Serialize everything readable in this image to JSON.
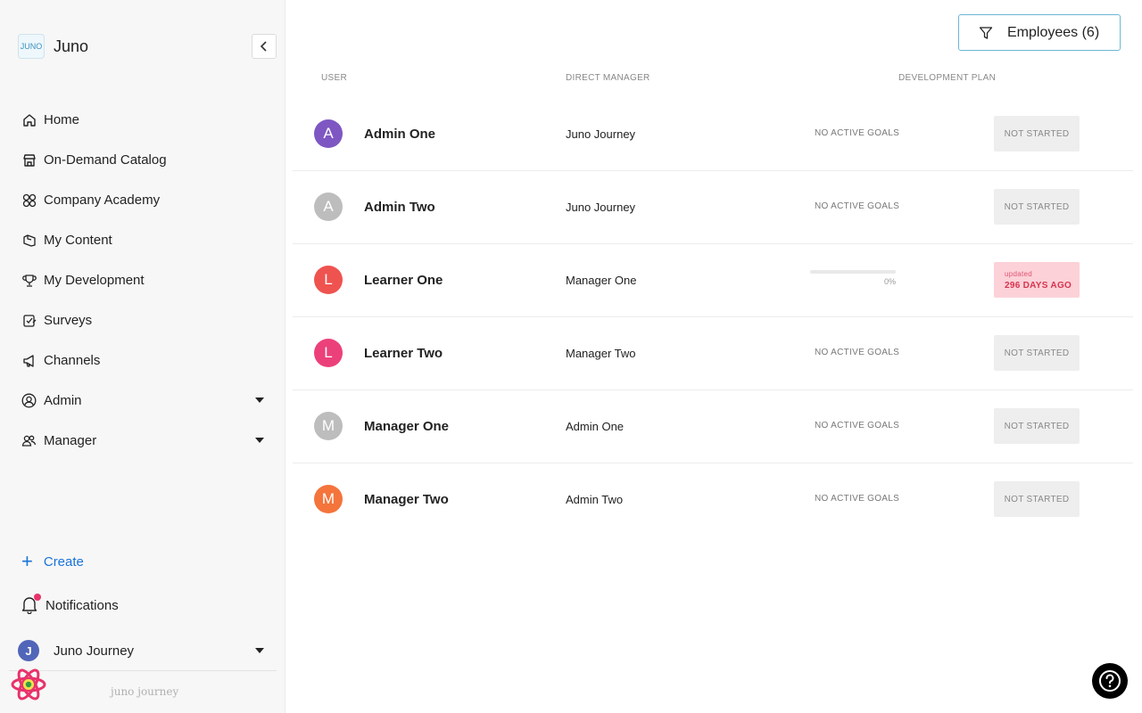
{
  "brand": {
    "name": "Juno",
    "logo_text": "JUNO"
  },
  "sidebar": {
    "items": [
      {
        "label": "Home",
        "icon": "home-icon"
      },
      {
        "label": "On-Demand Catalog",
        "icon": "store-icon"
      },
      {
        "label": "Company Academy",
        "icon": "grid-circles-icon"
      },
      {
        "label": "My Content",
        "icon": "folder-icon"
      },
      {
        "label": "My Development",
        "icon": "trophy-icon"
      },
      {
        "label": "Surveys",
        "icon": "survey-icon"
      },
      {
        "label": "Channels",
        "icon": "megaphone-icon"
      },
      {
        "label": "Admin",
        "icon": "user-circle-icon"
      },
      {
        "label": "Manager",
        "icon": "users-icon"
      }
    ],
    "create_label": "Create",
    "notifications_label": "Notifications",
    "user": {
      "initial": "J",
      "name": "Juno Journey"
    },
    "footer_logo": "juno journey"
  },
  "filter": {
    "label": "Employees (6)"
  },
  "table": {
    "headers": {
      "user": "USER",
      "manager": "DIRECT MANAGER",
      "plan": "DEVELOPMENT PLAN"
    },
    "rows": [
      {
        "initial": "A",
        "name": "Admin One",
        "manager": "Juno Journey",
        "goals": "NO ACTIVE GOALS",
        "status": "NOT STARTED",
        "color": "#7e57c2"
      },
      {
        "initial": "A",
        "name": "Admin Two",
        "manager": "Juno Journey",
        "goals": "NO ACTIVE GOALS",
        "status": "NOT STARTED",
        "color": "#bdbdbd"
      },
      {
        "initial": "L",
        "name": "Learner One",
        "manager": "Manager One",
        "progress": 0,
        "progress_label": "0%",
        "updated_label": "updated",
        "updated_value": "296 DAYS AGO",
        "color": "#ef5350"
      },
      {
        "initial": "L",
        "name": "Learner Two",
        "manager": "Manager Two",
        "goals": "NO ACTIVE GOALS",
        "status": "NOT STARTED",
        "color": "#ec407a"
      },
      {
        "initial": "M",
        "name": "Manager One",
        "manager": "Admin One",
        "goals": "NO ACTIVE GOALS",
        "status": "NOT STARTED",
        "color": "#bdbdbd"
      },
      {
        "initial": "M",
        "name": "Manager Two",
        "manager": "Admin Two",
        "goals": "NO ACTIVE GOALS",
        "status": "NOT STARTED",
        "color": "#f4743b"
      }
    ]
  },
  "colors": {
    "accent": "#1a73d9",
    "notification_dot": "#e8336b",
    "updated_bg": "#fcd1d8"
  }
}
